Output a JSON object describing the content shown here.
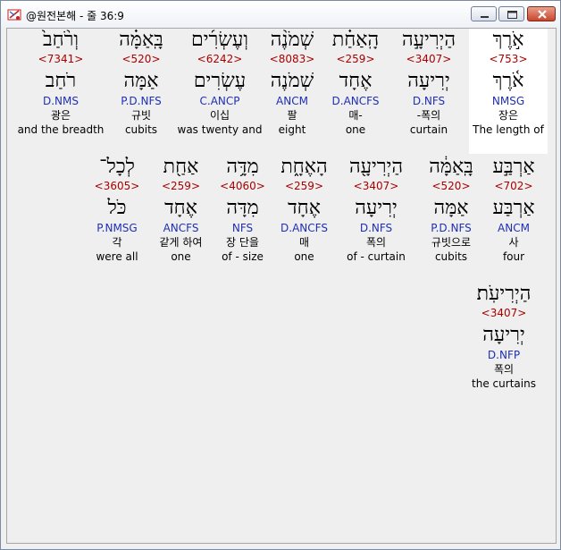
{
  "window": {
    "title": "@원전본해 - 줄 36:9",
    "icon": "bible-app-icon",
    "buttons": {
      "minimize": "minimize-icon",
      "maximize": "maximize-icon",
      "close": "close-icon"
    }
  },
  "colors": {
    "strong": "#aa0000",
    "morph": "#1f2fb5",
    "highlight": "#ffffff",
    "background": "#efefef"
  },
  "words": [
    {
      "heb": "אֹ֣רֶךְ",
      "strong": "<753>",
      "lex": "אֹ֫רֶךְ",
      "morph": "NMSG",
      "kor": "장은",
      "eng": "The length of",
      "highlight": true
    },
    {
      "heb": "הַיְרִיעָ֣ה",
      "strong": "<3407>",
      "lex": "יְרִיעָה",
      "morph": "D.NFS",
      "kor": "-폭의",
      "eng": "curtain"
    },
    {
      "heb": "הָֽאַחַ֗ת",
      "strong": "<259>",
      "lex": "אֶחָד",
      "morph": "D.ANCFS",
      "kor": "매-",
      "eng": "one"
    },
    {
      "heb": "שְׁמֹנֶ֨ה",
      "strong": "<8083>",
      "lex": "שְׁמֹנֶה",
      "morph": "ANCM",
      "kor": "팔",
      "eng": "eight"
    },
    {
      "heb": "וְעֶשְׂרִ֜ים",
      "strong": "<6242>",
      "lex": "עֶשְׂרִים",
      "morph": "C.ANCP",
      "kor": "이십",
      "eng": "was twenty and"
    },
    {
      "heb": "בָּֽאַמָּ֗ה",
      "strong": "<520>",
      "lex": "אַמָּה",
      "morph": "P.D.NFS",
      "kor": "규빗",
      "eng": "cubits"
    },
    {
      "heb": "וְרֹ֨חַב֙",
      "strong": "<7341>",
      "lex": "רֹחַב",
      "morph": "D.NMS",
      "kor": "광은",
      "eng": "and the breadth"
    },
    {
      "heb": "אַרְבַּ֣ע",
      "strong": "<702>",
      "lex": "אַרְבַּע",
      "morph": "ANCM",
      "kor": "사",
      "eng": "four"
    },
    {
      "heb": "בָּֽאַמָּ֔ה",
      "strong": "<520>",
      "lex": "אַמָּה",
      "morph": "P.D.NFS",
      "kor": "규빗으로",
      "eng": "cubits"
    },
    {
      "heb": "הַיְרִיעָ֖ה",
      "strong": "<3407>",
      "lex": "יְרִיעָה",
      "morph": "D.NFS",
      "kor": "폭의",
      "eng": "of - curtain"
    },
    {
      "heb": "הָאֶחָ֑ת",
      "strong": "<259>",
      "lex": "אֶחָד",
      "morph": "D.ANCFS",
      "kor": "매",
      "eng": "one"
    },
    {
      "heb": "מִדָּ֥ה",
      "strong": "<4060>",
      "lex": "מִדָּה",
      "morph": "NFS",
      "kor": "장 단을",
      "eng": "of - size"
    },
    {
      "heb": "אַחַ֖ת",
      "strong": "<259>",
      "lex": "אֶחָד",
      "morph": "ANCFS",
      "kor": "같게 하여",
      "eng": "one"
    },
    {
      "heb": "לְכָל־",
      "strong": "<3605>",
      "lex": "כֹּל",
      "morph": "P.NMSG",
      "kor": "각",
      "eng": "were all"
    },
    {
      "heb": "הַיְרִיעֹֽת׃",
      "strong": "<3407>",
      "lex": "יְרִיעָה",
      "morph": "D.NFP",
      "kor": "폭의",
      "eng": "the curtains"
    }
  ]
}
